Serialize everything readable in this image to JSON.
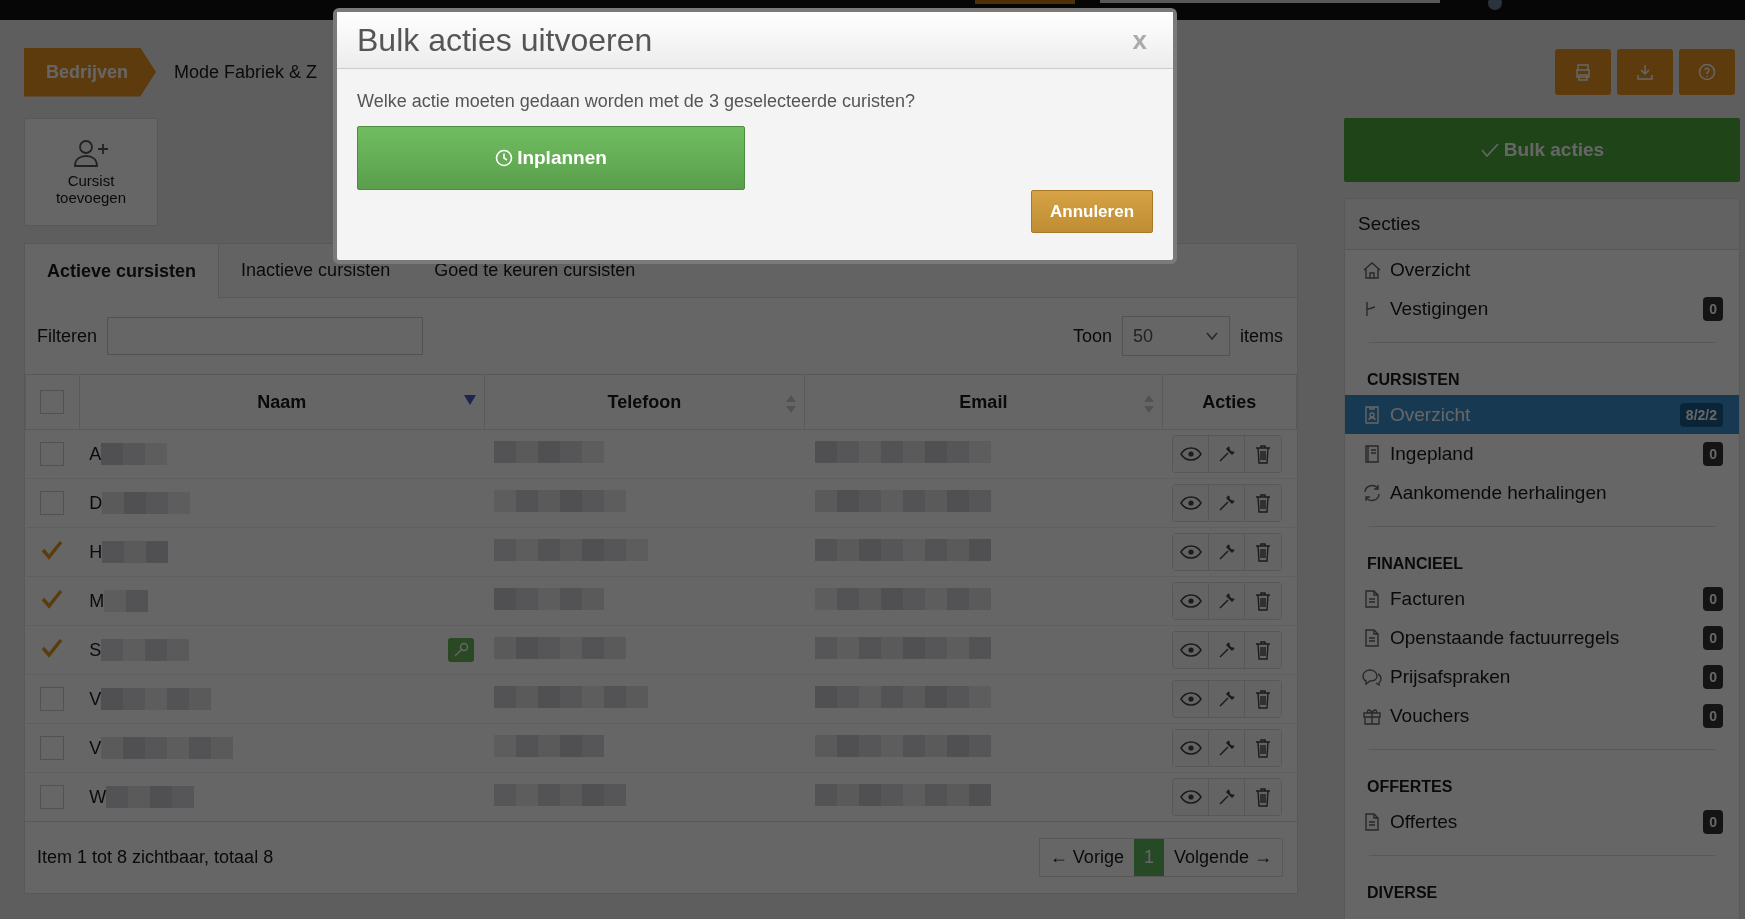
{
  "breadcrumb": [
    {
      "label": "Bedrijven",
      "kind": "active"
    },
    {
      "label": "Mode Fabriek & Z",
      "kind": "plain"
    }
  ],
  "add_button": {
    "label": "Cursist toevoegen"
  },
  "tabs": [
    {
      "label": "Actieve cursisten",
      "selected": true
    },
    {
      "label": "Inactieve cursisten",
      "selected": false
    },
    {
      "label": "Goed te keuren cursisten",
      "selected": false
    }
  ],
  "filter": {
    "label": "Filteren"
  },
  "page_size": {
    "label": "Toon",
    "value": "50",
    "suffix": "items"
  },
  "table": {
    "columns": [
      {
        "label": "Naam",
        "kind": "sorted"
      },
      {
        "label": "Telefoon",
        "kind": "sortable"
      },
      {
        "label": "Email",
        "kind": "sortable"
      },
      {
        "label": "Acties",
        "kind": "plain"
      }
    ],
    "select_all": {
      "checked": false
    },
    "rows": [
      {
        "initial": "A",
        "checked": false,
        "key_badge": false
      },
      {
        "initial": "D",
        "checked": false,
        "key_badge": false
      },
      {
        "initial": "H",
        "checked": true,
        "key_badge": false
      },
      {
        "initial": "M",
        "checked": true,
        "key_badge": false
      },
      {
        "initial": "S",
        "checked": true,
        "key_badge": true
      },
      {
        "initial": "V",
        "checked": false,
        "key_badge": false
      },
      {
        "initial": "V",
        "checked": false,
        "key_badge": false
      },
      {
        "initial": "W",
        "checked": false,
        "key_badge": false
      }
    ]
  },
  "footer": {
    "summary": "Item 1 tot 8 zichtbaar, totaal 8",
    "previous": "← Vorige",
    "pages": [
      {
        "label": "1",
        "selected": true
      }
    ],
    "next": "Volgende →"
  },
  "sidebar": {
    "bulk_button": "Bulk acties",
    "title": "Secties",
    "groups": [
      {
        "items": [
          {
            "label": "Overzicht",
            "selected": false
          },
          {
            "label": "Vestigingen",
            "badge": "0",
            "selected": false
          }
        ]
      },
      {
        "heading": "CURSISTEN",
        "items": [
          {
            "label": "Overzicht",
            "badge": "8/2/2",
            "selected": true
          },
          {
            "label": "Ingepland",
            "badge": "0",
            "selected": false
          },
          {
            "label": "Aankomende herhalingen",
            "selected": false
          }
        ]
      },
      {
        "heading": "FINANCIEEL",
        "items": [
          {
            "label": "Facturen",
            "badge": "0",
            "selected": false
          },
          {
            "label": "Openstaande factuurregels",
            "badge": "0",
            "selected": false
          },
          {
            "label": "Prijsafspraken",
            "badge": "0",
            "selected": false
          },
          {
            "label": "Vouchers",
            "badge": "0",
            "selected": false
          }
        ]
      },
      {
        "heading": "OFFERTES",
        "items": [
          {
            "label": "Offertes",
            "badge": "0",
            "selected": false
          }
        ]
      },
      {
        "heading": "DIVERSE"
      }
    ]
  },
  "modal": {
    "title": "Bulk acties uitvoeren",
    "close": "x",
    "message": "Welke actie moeten gedaan worden met de 3 geselecteerde curisten?",
    "action": "Inplannen",
    "cancel": "Annuleren"
  }
}
